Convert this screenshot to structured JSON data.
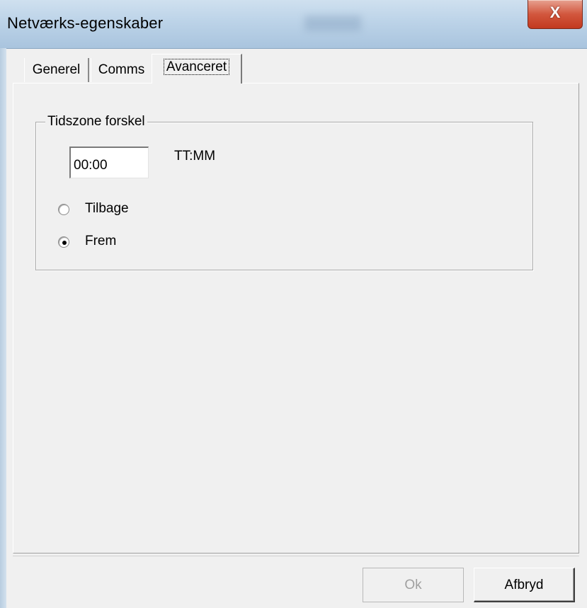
{
  "window": {
    "title": "Netværks-egenskaber",
    "close_glyph": "X"
  },
  "tabs": [
    {
      "label": "Generel",
      "selected": false
    },
    {
      "label": "Comms",
      "selected": false
    },
    {
      "label": "Avanceret",
      "selected": true
    }
  ],
  "timezone_group": {
    "legend": "Tidszone forskel",
    "offset_value": "00:00",
    "offset_format": "TT:MM",
    "radios": [
      {
        "label": "Tilbage",
        "checked": false
      },
      {
        "label": "Frem",
        "checked": true
      }
    ]
  },
  "buttons": {
    "ok_label": "Ok",
    "ok_enabled": false,
    "cancel_label": "Afbryd"
  },
  "colors": {
    "titlebar": "#bcd3e8",
    "close_button": "#c2391f",
    "dialog_background": "#f0f0f0",
    "disabled_text": "#a0a0a0"
  },
  "icons": {
    "close": "close-icon",
    "radio_unchecked": "radio-unchecked-icon",
    "radio_checked": "radio-checked-icon"
  }
}
